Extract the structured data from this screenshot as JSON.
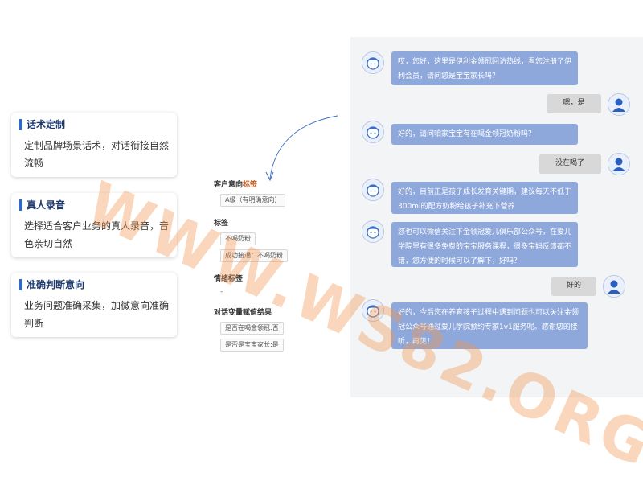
{
  "cards": [
    {
      "title": "话术定制",
      "desc": "定制品牌场景话术，对话衔接自然流畅"
    },
    {
      "title": "真人录音",
      "desc": "选择适合客户业务的真人录音，音色亲切自然"
    },
    {
      "title": "准确判断意向",
      "desc": "业务问题准确采集，加微意向准确判断"
    }
  ],
  "tags_panel": {
    "intent": {
      "title_prefix": "客户意向",
      "title_highlight": "标签",
      "tag": "A级（有明确意向）"
    },
    "labels": {
      "title": "标签",
      "items": [
        "不喝奶粉",
        "成功接通：不喝奶粉"
      ]
    },
    "emotion": {
      "title": "情绪标签",
      "value": "-"
    },
    "vars": {
      "title": "对话变量赋值结果",
      "items": [
        "是否在喝金领冠:否",
        "是否是宝宝家长:是"
      ]
    }
  },
  "chat": {
    "messages": [
      {
        "from": "bot",
        "text": "哎，您好，这里是伊利金领冠回访热线，看您注册了伊利会员，请问您是宝宝家长吗？"
      },
      {
        "from": "user",
        "text": "嗯，是"
      },
      {
        "from": "bot",
        "text": "好的，请问咱家宝宝有在喝金领冠奶粉吗？"
      },
      {
        "from": "user",
        "text": "没在喝了"
      },
      {
        "from": "bot",
        "text": "好的，目前正是孩子成长发育关键期，建议每天不低于300ml的配方奶粉给孩子补充下营养"
      },
      {
        "from": "bot",
        "text": "您也可以微信关注下金领冠爱儿俱乐部公众号，在爱儿学院里有很多免费的宝宝服务课程，很多宝妈反馈都不错，您方便的时候可以了解下，好吗？"
      },
      {
        "from": "user",
        "text": "好的"
      },
      {
        "from": "bot",
        "text": "好的，今后您在养育孩子过程中遇到问题也可以关注金领冠公众号通过爱儿学院预约专家1v1服务呢。感谢您的接听，再见！"
      }
    ]
  },
  "watermark": "WWW.WS82.ORG",
  "colors": {
    "bot_bubble": "#8fa8dc",
    "user_bubble": "#d8d8d8",
    "accent": "#2a6ad4",
    "watermark": "#f39650"
  }
}
